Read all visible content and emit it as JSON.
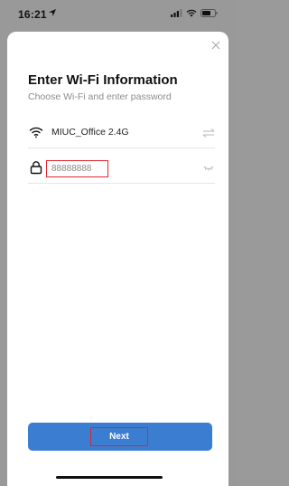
{
  "status_bar": {
    "time": "16:21",
    "icons": [
      "location-arrow-icon",
      "cellular-signal-icon",
      "wifi-icon",
      "battery-icon"
    ]
  },
  "dialog": {
    "title": "Enter Wi-Fi Information",
    "subtitle": "Choose Wi-Fi and enter password",
    "close_icon": "close-icon",
    "wifi_row": {
      "icon": "wifi-icon",
      "network_name": "MIUC_Office 2.4G",
      "switch_icon": "switch-network-icon"
    },
    "password_row": {
      "icon": "lock-icon",
      "value": "88888888",
      "visibility_icon": "eye-closed-icon"
    },
    "next_button": {
      "label": "Next"
    }
  },
  "colors": {
    "accent": "#3b7dd1",
    "highlight_border": "#e0262d",
    "backdrop": "#999999"
  }
}
